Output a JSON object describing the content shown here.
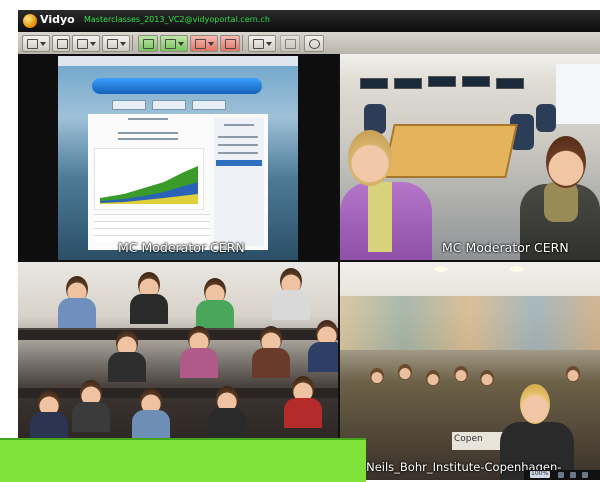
{
  "window": {
    "app_name": "Vidyo",
    "conference_title": "Masterclasses_2013_VC2@vidyoportal.cern.ch"
  },
  "toolbar": {
    "buttons": [
      {
        "name": "layout-button",
        "icon": "grid-layout-icon"
      },
      {
        "name": "self-view-button",
        "icon": "self-view-icon"
      },
      {
        "name": "share-button",
        "icon": "monitor-icon"
      },
      {
        "name": "devices-button",
        "icon": "devices-icon"
      },
      {
        "name": "camera-button",
        "icon": "camera-icon",
        "state": "on"
      },
      {
        "name": "speaker-button",
        "icon": "speaker-icon",
        "state": "on"
      },
      {
        "name": "microphone-button",
        "icon": "microphone-icon",
        "state": "muted"
      },
      {
        "name": "video-mute-button",
        "icon": "video-icon",
        "state": "muted"
      },
      {
        "name": "participants-button",
        "icon": "participants-icon"
      },
      {
        "name": "chat-button",
        "icon": "chat-icon"
      },
      {
        "name": "settings-button",
        "icon": "gear-icon"
      }
    ],
    "colors": {
      "on": "#79c25c",
      "muted": "#e07466"
    }
  },
  "tiles": [
    {
      "id": "share",
      "caption": "MC Moderator CERN"
    },
    {
      "id": "cern",
      "caption": "MC Moderator CERN"
    },
    {
      "id": "class",
      "caption": ""
    },
    {
      "id": "cph",
      "caption": "MC-Neils_Bohr_Institute-Copenhagen-"
    }
  ],
  "shared_screen": {
    "sign_text": "Copen"
  },
  "tray": {
    "badge": "100%"
  }
}
